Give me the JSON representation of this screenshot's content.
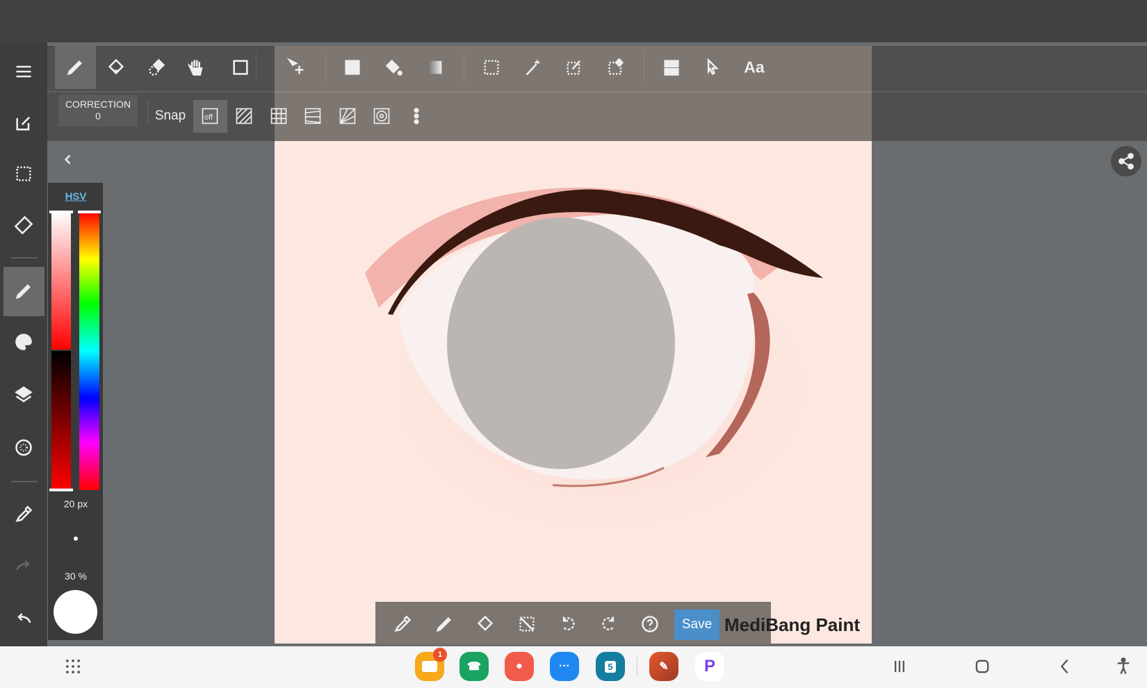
{
  "toolbar": {
    "correction_label": "CORRECTION",
    "correction_value": "0",
    "snap_label": "Snap",
    "snap_off": "off",
    "text_tool": "Aa"
  },
  "color_panel": {
    "mode": "HSV",
    "brush_size": "20 px",
    "opacity": "30 %",
    "color": "#ffffff"
  },
  "bottom_toolbar": {
    "save_label": "Save",
    "logo": "MediBang Paint"
  },
  "taskbar": {
    "files_badge": "1",
    "calendar_day": "5"
  },
  "colors": {
    "accent": "#4a8fc9",
    "canvas": "#fde8e1",
    "hsv_link": "#6ab7ea"
  }
}
